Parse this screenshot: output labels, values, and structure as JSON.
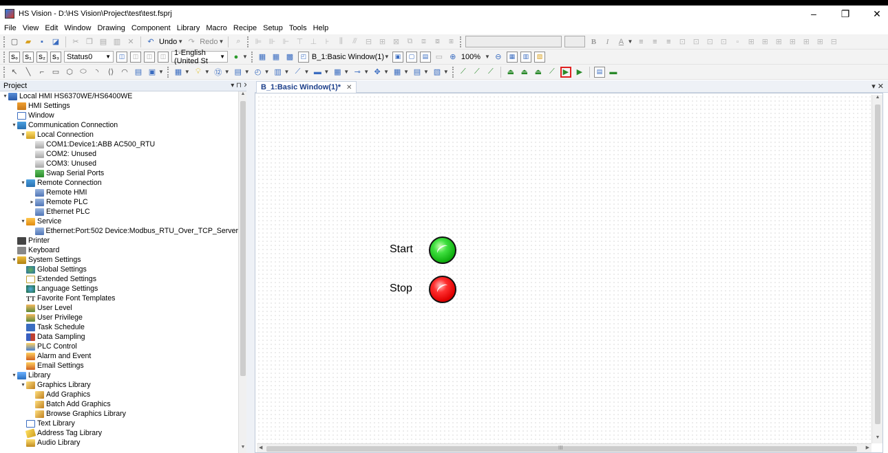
{
  "window": {
    "title": "HS Vision - D:\\HS Vision\\Project\\test\\test.fsprj",
    "controls": {
      "minimize": "–",
      "restore": "❐",
      "close": "✕"
    }
  },
  "menu": [
    "File",
    "View",
    "Edit",
    "Window",
    "Drawing",
    "Component",
    "Library",
    "Macro",
    "Recipe",
    "Setup",
    "Tools",
    "Help"
  ],
  "toolbar1": {
    "undo": "Undo",
    "redo": "Redo"
  },
  "toolbar2": {
    "status_combo": "Status0",
    "language_combo": "1-English (United St",
    "window_combo": "B_1:Basic Window(1)",
    "zoom": "100%"
  },
  "project_panel": {
    "title": "Project",
    "controls": "▾ ⊓ ✕"
  },
  "tree": [
    {
      "label": "Local HMI HS6370WE/HS6400WE",
      "level": 0,
      "expander": "▾",
      "icon": "i-hmi",
      "name": "local-hmi"
    },
    {
      "label": "HMI Settings",
      "level": 1,
      "expander": "",
      "icon": "i-set",
      "name": "hmi-settings"
    },
    {
      "label": "Window",
      "level": 1,
      "expander": "",
      "icon": "i-win",
      "name": "window"
    },
    {
      "label": "Communication Connection",
      "level": 1,
      "expander": "▾",
      "icon": "i-net",
      "name": "communication-connection"
    },
    {
      "label": "Local Connection",
      "level": 2,
      "expander": "▾",
      "icon": "i-plug",
      "name": "local-connection"
    },
    {
      "label": "COM1:Device1:ABB AC500_RTU",
      "level": 3,
      "expander": "",
      "icon": "i-port",
      "name": "com1"
    },
    {
      "label": "COM2: Unused",
      "level": 3,
      "expander": "",
      "icon": "i-port",
      "name": "com2"
    },
    {
      "label": "COM3: Unused",
      "level": 3,
      "expander": "",
      "icon": "i-port",
      "name": "com3"
    },
    {
      "label": "Swap Serial Ports",
      "level": 3,
      "expander": "",
      "icon": "i-swap",
      "name": "swap-serial-ports"
    },
    {
      "label": "Remote Connection",
      "level": 2,
      "expander": "▾",
      "icon": "i-net",
      "name": "remote-connection"
    },
    {
      "label": "Remote HMI",
      "level": 3,
      "expander": "",
      "icon": "i-dev",
      "name": "remote-hmi"
    },
    {
      "label": "Remote PLC",
      "level": 3,
      "expander": "▸",
      "icon": "i-dev",
      "name": "remote-plc"
    },
    {
      "label": "Ethernet PLC",
      "level": 3,
      "expander": "",
      "icon": "i-dev",
      "name": "ethernet-plc"
    },
    {
      "label": "Service",
      "level": 2,
      "expander": "▾",
      "icon": "i-svc",
      "name": "service"
    },
    {
      "label": "Ethernet:Port:502 Device:Modbus_RTU_Over_TCP_Server",
      "level": 3,
      "expander": "",
      "icon": "i-dev",
      "name": "ethernet-port-502"
    },
    {
      "label": "Printer",
      "level": 1,
      "expander": "",
      "icon": "i-prn",
      "name": "printer"
    },
    {
      "label": "Keyboard",
      "level": 1,
      "expander": "",
      "icon": "i-kbd",
      "name": "keyboard"
    },
    {
      "label": "System Settings",
      "level": 1,
      "expander": "▾",
      "icon": "i-sys",
      "name": "system-settings"
    },
    {
      "label": "Global Settings",
      "level": 2,
      "expander": "",
      "icon": "i-glob",
      "name": "global-settings"
    },
    {
      "label": "Extended Settings",
      "level": 2,
      "expander": "",
      "icon": "i-ext",
      "name": "extended-settings"
    },
    {
      "label": "Language Settings",
      "level": 2,
      "expander": "",
      "icon": "i-lang",
      "name": "language-settings"
    },
    {
      "label": "Favorite Font Templates",
      "level": 2,
      "expander": "",
      "icon": "i-font",
      "glyph": "TT",
      "name": "favorite-font-templates"
    },
    {
      "label": "User Level",
      "level": 2,
      "expander": "",
      "icon": "i-user",
      "name": "user-level"
    },
    {
      "label": "User Privilege",
      "level": 2,
      "expander": "",
      "icon": "i-user",
      "name": "user-privilege"
    },
    {
      "label": "Task Schedule",
      "level": 2,
      "expander": "",
      "icon": "i-task",
      "name": "task-schedule"
    },
    {
      "label": "Data Sampling",
      "level": 2,
      "expander": "",
      "icon": "i-data",
      "name": "data-sampling"
    },
    {
      "label": "PLC Control",
      "level": 2,
      "expander": "",
      "icon": "i-plc",
      "name": "plc-control"
    },
    {
      "label": "Alarm and Event",
      "level": 2,
      "expander": "",
      "icon": "i-alarm",
      "name": "alarm-and-event"
    },
    {
      "label": "Email Settings",
      "level": 2,
      "expander": "",
      "icon": "i-mail",
      "name": "email-settings"
    },
    {
      "label": "Library",
      "level": 1,
      "expander": "▾",
      "icon": "i-lib",
      "name": "library"
    },
    {
      "label": "Graphics Library",
      "level": 2,
      "expander": "▾",
      "icon": "i-gfx",
      "name": "graphics-library"
    },
    {
      "label": "Add Graphics",
      "level": 3,
      "expander": "",
      "icon": "i-gfx",
      "name": "add-graphics"
    },
    {
      "label": "Batch Add Graphics",
      "level": 3,
      "expander": "",
      "icon": "i-gfx",
      "name": "batch-add-graphics"
    },
    {
      "label": "Browse Graphics Library",
      "level": 3,
      "expander": "",
      "icon": "i-gfx",
      "name": "browse-graphics-library"
    },
    {
      "label": "Text Library",
      "level": 2,
      "expander": "",
      "icon": "i-text",
      "name": "text-library"
    },
    {
      "label": "Address Tag Library",
      "level": 2,
      "expander": "",
      "icon": "i-tag",
      "name": "address-tag-library"
    },
    {
      "label": "Audio Library",
      "level": 2,
      "expander": "",
      "icon": "i-audio",
      "name": "audio-library"
    }
  ],
  "editor": {
    "tab_label": "B_1:Basic Window(1)*",
    "tab_close": "✕",
    "pin": "▾ ✕",
    "scroll_grip": "III"
  },
  "canvas_objects": {
    "start_label": "Start",
    "stop_label": "Stop",
    "start_lamp_color": "#20c020",
    "stop_lamp_color": "#e00000"
  }
}
